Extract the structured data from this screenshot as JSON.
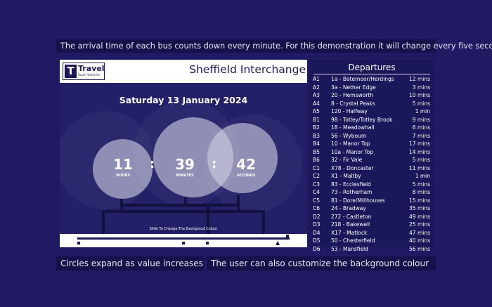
{
  "captions": {
    "top": "The arrival time of each bus counts down every minute. For this demonstration it will change every five seconds",
    "bottom_left": "Circles expand as value increases",
    "bottom_right": "The user can also customize the background colour"
  },
  "logo": {
    "mark": "T",
    "word": "Travel",
    "sub": "South Yorkshire"
  },
  "station": "Sheffield Interchange",
  "date": "Saturday 13 January 2024",
  "clock": {
    "hours": {
      "value": "11",
      "label": "HOURS"
    },
    "minutes": {
      "value": "39",
      "label": "MINUTES"
    },
    "seconds": {
      "value": "42",
      "label": "SECONDS"
    },
    "separator": ":"
  },
  "slider": {
    "label": "Slide To Change The Backgroud Colour"
  },
  "departures": {
    "title": "Departures",
    "rows": [
      {
        "stand": "A1",
        "route": "1a - Batemoor/Herdings",
        "mins": "12 mins"
      },
      {
        "stand": "A2",
        "route": "3a - Nether Edge",
        "mins": "3 mins"
      },
      {
        "stand": "A3",
        "route": "20 - Hemsworth",
        "mins": "10 mins"
      },
      {
        "stand": "A4",
        "route": "8 - Crystal Peaks",
        "mins": "5 mins"
      },
      {
        "stand": "A5",
        "route": "120 - Halfway",
        "mins": "1 min"
      },
      {
        "stand": "B1",
        "route": "98 - Totley/Totley Brook",
        "mins": "9 mins"
      },
      {
        "stand": "B2",
        "route": "18 - Meadowhall",
        "mins": "6 mins"
      },
      {
        "stand": "B3",
        "route": "56 - Wybourn",
        "mins": "7 mins"
      },
      {
        "stand": "B4",
        "route": "10 - Manor Top",
        "mins": "17 mins"
      },
      {
        "stand": "B5",
        "route": "10a - Manor Top",
        "mins": "14 mins"
      },
      {
        "stand": "B6",
        "route": "32 - Fir Vale",
        "mins": "5 mins"
      },
      {
        "stand": "C1",
        "route": "X78 - Doncaster",
        "mins": "11 mins"
      },
      {
        "stand": "C2",
        "route": "X1 - Maltby",
        "mins": "1 min"
      },
      {
        "stand": "C3",
        "route": "83 - Ecclesfield",
        "mins": "5 mins"
      },
      {
        "stand": "C4",
        "route": "73 - Rotherham",
        "mins": "8 mins"
      },
      {
        "stand": "C5",
        "route": "81 - Dore/Millhouses",
        "mins": "15 mins"
      },
      {
        "stand": "C6",
        "route": "24 - Bradway",
        "mins": "35 mins"
      },
      {
        "stand": "D2",
        "route": "272 - Castleton",
        "mins": "49 mins"
      },
      {
        "stand": "D3",
        "route": "218 - Bakewell",
        "mins": "25 mins"
      },
      {
        "stand": "D4",
        "route": "X17 - Matlock",
        "mins": "47 mins"
      },
      {
        "stand": "D5",
        "route": "50 - Chesterfield",
        "mins": "40 mins"
      },
      {
        "stand": "D6",
        "route": "53 - Mansfield",
        "mins": "56 mins"
      }
    ]
  }
}
